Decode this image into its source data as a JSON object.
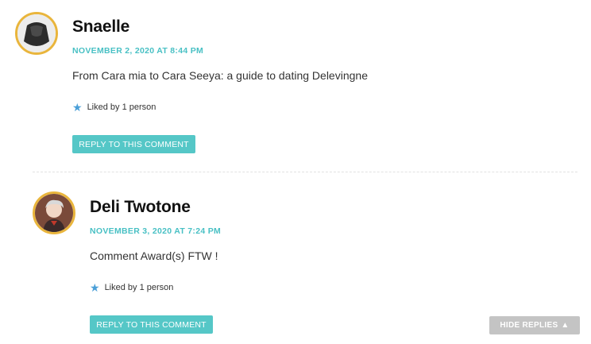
{
  "comments": [
    {
      "author": "Snaelle",
      "date": "NOVEMBER 2, 2020 AT 8:44 PM",
      "text": "From Cara mia to Cara Seeya: a guide to dating Delevingne",
      "likes": "Liked by 1 person",
      "reply_label": "REPLY TO THIS COMMENT",
      "avatar_icon": "dark-figure-avatar"
    },
    {
      "author": "Deli Twotone",
      "date": "NOVEMBER 3, 2020 AT 7:24 PM",
      "text": "Comment Award(s) FTW !",
      "likes": "Liked by 1 person",
      "reply_label": "REPLY TO THIS COMMENT",
      "avatar_icon": "cartoon-character-avatar"
    }
  ],
  "hide_replies_label": "HIDE REPLIES",
  "hide_replies_icon": "triangle-up-icon",
  "like_icon": "star-icon",
  "colors": {
    "accent": "#55c7c7",
    "date": "#48c0c4",
    "avatar_border": "#e9b53c",
    "star": "#4a9fd8",
    "hide_button": "#c4c4c4"
  }
}
